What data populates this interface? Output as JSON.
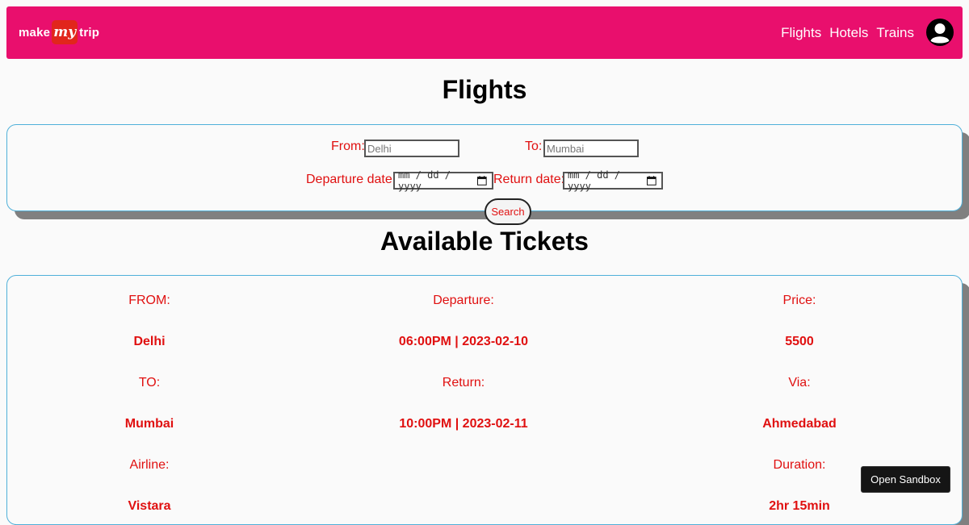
{
  "brand": {
    "logo_make": "make",
    "logo_my": "my",
    "logo_trip": "trip",
    "accent_color": "#e90f6d",
    "text_accent_color": "#e01010"
  },
  "nav": {
    "links": [
      "Flights",
      "Hotels",
      "Trains"
    ],
    "avatar_icon": "user-circle-icon"
  },
  "page": {
    "title": "Flights"
  },
  "search": {
    "from_label": "From:",
    "from_placeholder": "Delhi",
    "to_label": "To:",
    "to_placeholder": "Mumbai",
    "departure_label": "Departure date:",
    "departure_placeholder": "mm / dd / yyyy",
    "return_label": "Return date:",
    "return_placeholder": "mm / dd / yyyy",
    "calendar_icon": "calendar-icon",
    "button_label": "Search"
  },
  "tickets": {
    "title": "Available Tickets",
    "from_label": "FROM:",
    "from_value": "Delhi",
    "to_label": "TO:",
    "to_value": "Mumbai",
    "airline_label": "Airline:",
    "airline_value": "Vistara",
    "departure_label": "Departure:",
    "departure_value": "06:00PM | 2023-02-10",
    "return_label": "Return:",
    "return_value": "10:00PM | 2023-02-11",
    "price_label": "Price:",
    "price_value": "5500",
    "via_label": "Via:",
    "via_value": "Ahmedabad",
    "duration_label": "Duration:",
    "duration_value": "2hr 15min"
  },
  "sandbox": {
    "button_label": "Open Sandbox"
  }
}
